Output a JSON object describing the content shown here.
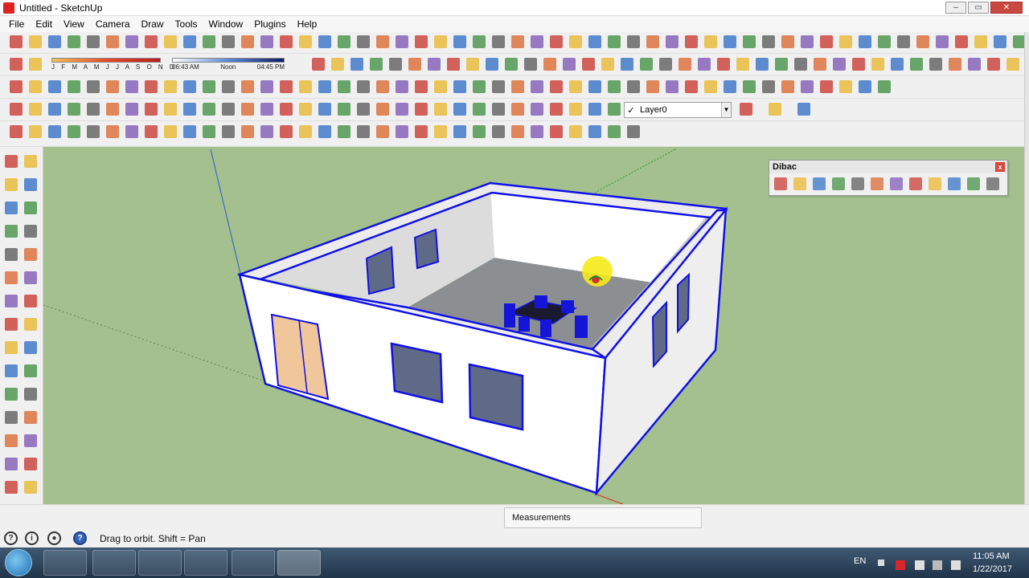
{
  "window": {
    "title": "Untitled - SketchUp"
  },
  "menu": [
    "File",
    "Edit",
    "View",
    "Camera",
    "Draw",
    "Tools",
    "Window",
    "Plugins",
    "Help"
  ],
  "shadows": {
    "months": "J F M A M J J A S O N D",
    "time_start": "06:43 AM",
    "time_noon": "Noon",
    "time_end": "04:45 PM"
  },
  "layer": {
    "name": "Layer0",
    "check": "✓"
  },
  "dibac": {
    "title": "Dibac",
    "close": "x"
  },
  "status": {
    "hint": "Drag to orbit.  Shift = Pan",
    "measurements_label": "Measurements"
  },
  "taskbar": {
    "language": "EN",
    "time": "11:05 AM",
    "date": "1/22/2017"
  },
  "colors": {
    "sky_ground": "#a3c08e",
    "selection_blue": "#1010e6",
    "wall_white": "#ffffff",
    "floor_gray": "#8c8f91",
    "door_wood": "#f0c79a",
    "icon_red": "#c8302a",
    "icon_yellow": "#e8b427"
  },
  "icons": {
    "toolbar_row1": [
      "paint-bucket-icon",
      "eraser-icon",
      "save-icon",
      "scissors-icon",
      "copy-icon",
      "paste-icon",
      "delete-icon",
      "undo-icon",
      "redo-icon",
      "print-icon",
      "model-info-icon"
    ],
    "left_palette": [
      "select-icon",
      "component-icon",
      "paint-icon",
      "eraser-icon",
      "rectangle-icon",
      "line-icon",
      "circle-icon",
      "arc-icon",
      "polygon-icon",
      "freehand-icon",
      "move-icon",
      "pushpull-icon",
      "rotate-icon",
      "followme-icon",
      "scale-icon",
      "offset-icon",
      "tape-icon",
      "dimension-icon",
      "protractor-icon",
      "text-icon",
      "axes-icon",
      "3dtext-icon",
      "orbit-icon",
      "pan-icon",
      "zoom-icon",
      "zoom-window-icon",
      "zoom-extents-icon",
      "previous-view-icon",
      "position-camera-icon",
      "look-around-icon"
    ],
    "dibac_tools": [
      "wall-icon",
      "door-icon",
      "window-icon",
      "arch-icon",
      "beam-icon",
      "stair-icon",
      "roof-icon",
      "furniture-icon",
      "floor-icon",
      "dimension-icon",
      "convert-icon",
      "settings-icon"
    ]
  }
}
